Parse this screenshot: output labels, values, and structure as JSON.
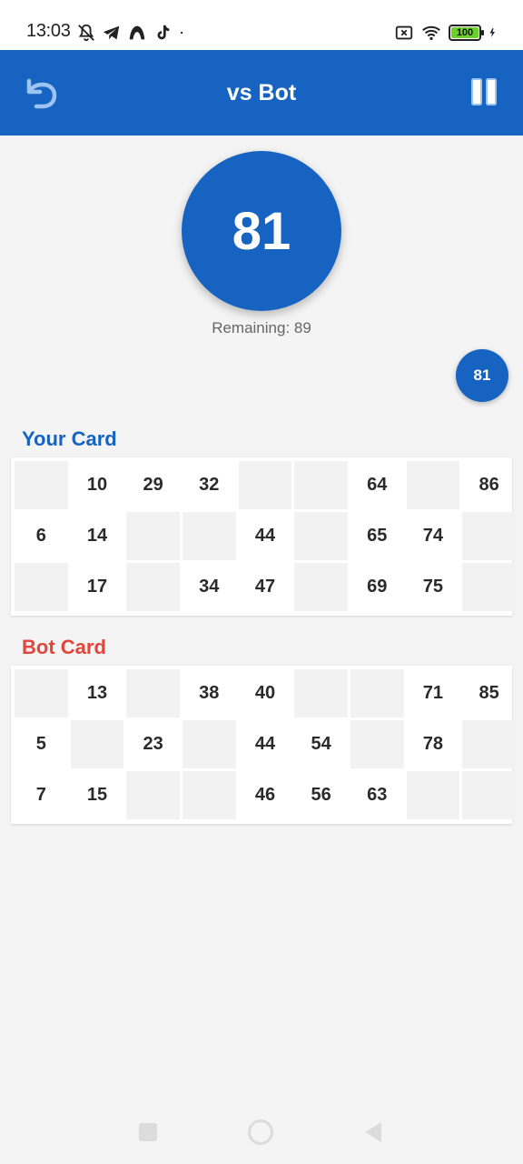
{
  "status_bar": {
    "time": "13:03",
    "battery": "100",
    "icons_left": [
      "bell-off-icon",
      "telegram-icon",
      "arc-icon",
      "tiktok-icon",
      "dot-icon"
    ],
    "icons_right": [
      "sim-off-icon",
      "wifi-icon",
      "battery-icon",
      "charging-icon"
    ]
  },
  "app_bar": {
    "title": "vs Bot",
    "back_icon": "undo-arrow-icon",
    "pause_icon": "pause-icon",
    "color": "#1763c1"
  },
  "current_ball": {
    "number": "81",
    "remaining_label": "Remaining: 89"
  },
  "history": [
    "81"
  ],
  "your_card": {
    "title": "Your Card",
    "title_color": "#1763c1",
    "rows": [
      [
        "",
        "10",
        "29",
        "32",
        "",
        "",
        "64",
        "",
        "86"
      ],
      [
        "6",
        "14",
        "",
        "",
        "44",
        "",
        "65",
        "74",
        ""
      ],
      [
        "",
        "17",
        "",
        "34",
        "47",
        "",
        "69",
        "75",
        ""
      ]
    ]
  },
  "bot_card": {
    "title": "Bot Card",
    "title_color": "#e2463b",
    "rows": [
      [
        "",
        "13",
        "",
        "38",
        "40",
        "",
        "",
        "71",
        "85"
      ],
      [
        "5",
        "",
        "23",
        "",
        "44",
        "54",
        "",
        "78",
        ""
      ],
      [
        "7",
        "15",
        "",
        "",
        "46",
        "56",
        "63",
        "",
        ""
      ]
    ]
  }
}
